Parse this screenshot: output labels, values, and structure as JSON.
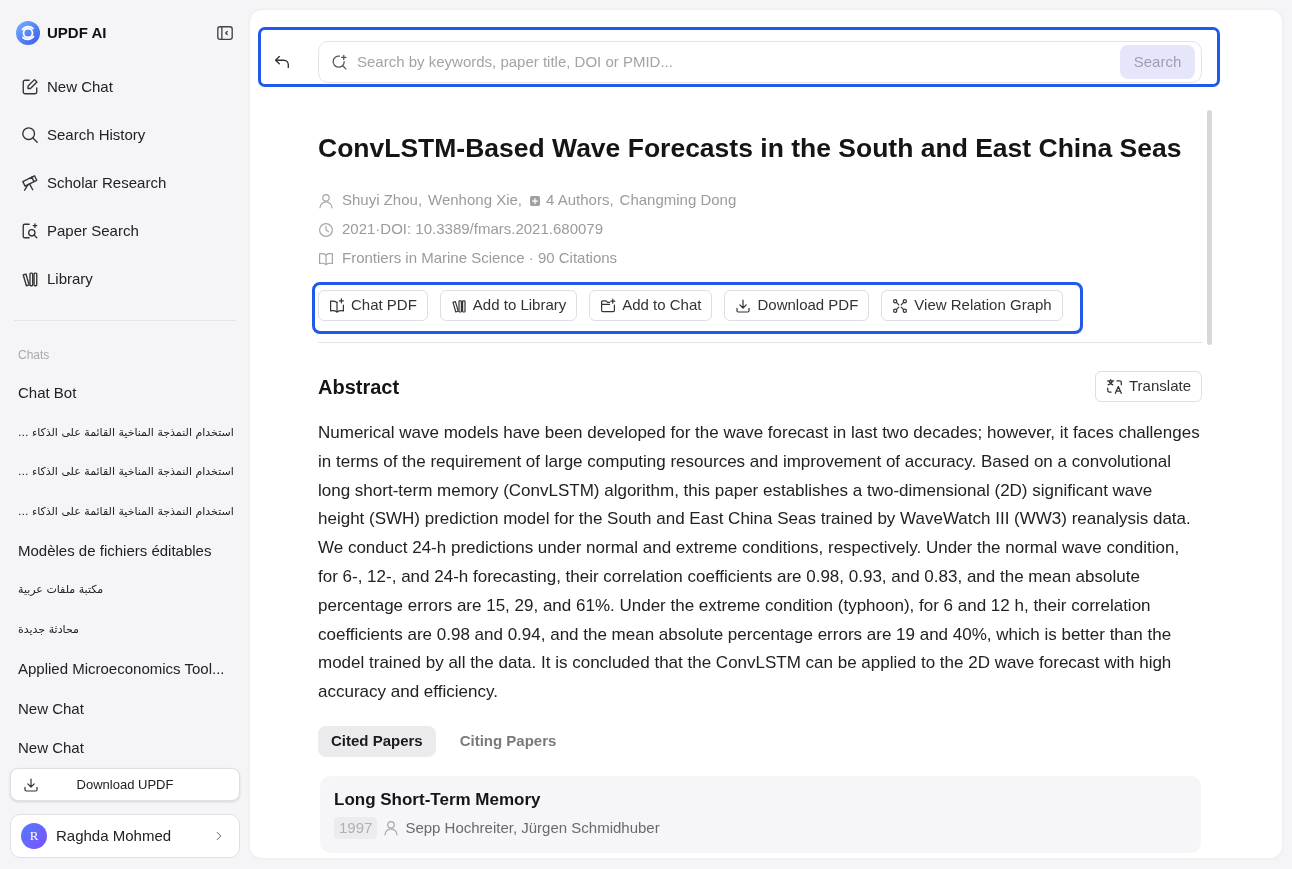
{
  "sidebar": {
    "logo_text": "UPDF AI",
    "nav": [
      {
        "label": "New Chat"
      },
      {
        "label": "Search History"
      },
      {
        "label": "Scholar Research"
      },
      {
        "label": "Paper Search"
      },
      {
        "label": "Library"
      }
    ],
    "chats_heading": "Chats",
    "chats": [
      {
        "kind": "ltr",
        "title": "Chat Bot"
      },
      {
        "kind": "rtl",
        "title": "استخدام النمذجة المناخية القائمة على الذكاء ..."
      },
      {
        "kind": "rtl",
        "title": "استخدام النمذجة المناخية القائمة على الذكاء ..."
      },
      {
        "kind": "rtl",
        "title": "استخدام النمذجة المناخية القائمة على الذكاء ..."
      },
      {
        "kind": "ltr",
        "title": "Modèles de fichiers éditables"
      },
      {
        "kind": "rtl",
        "title": "مكتبة ملفات عربية"
      },
      {
        "kind": "rtl",
        "title": "محادثة جديدة"
      },
      {
        "kind": "ltr",
        "title": "Applied Microeconomics Tool..."
      },
      {
        "kind": "ltr",
        "title": "New Chat"
      },
      {
        "kind": "ltr",
        "title": "New Chat"
      }
    ],
    "download_button": "Download UPDF",
    "user": {
      "avatar_letter": "R",
      "name": "Raghda Mohmed"
    }
  },
  "search": {
    "highlighted": true,
    "placeholder": "Search by keywords, paper title, DOI or PMID...",
    "button": "Search"
  },
  "paper": {
    "title": "ConvLSTM-Based Wave Forecasts in the South and East China Seas",
    "authors": [
      {
        "kind": "person",
        "name": "Shuyi Zhou,"
      },
      {
        "kind": "person",
        "name": "Wenhong Xie,"
      },
      {
        "kind": "more",
        "name": "4 Authors,"
      },
      {
        "kind": "person",
        "name": "Changming Dong"
      }
    ],
    "date_doi": "2021·DOI: 10.3389/fmars.2021.680079",
    "venue": "Frontiers in Marine Science · 90 Citations",
    "actions_highlighted": true,
    "actions": [
      "Chat PDF",
      "Add to Library",
      "Add to Chat",
      "Download PDF",
      "View Relation Graph"
    ]
  },
  "abstract": {
    "heading": "Abstract",
    "translate_button": "Translate",
    "text": "Numerical wave models have been developed for the wave forecast in last two decades; however, it faces challenges in terms of the requirement of large computing resources and improvement of accuracy. Based on a convolutional long short-term memory (ConvLSTM) algorithm, this paper establishes a two-dimensional (2D) significant wave height (SWH) prediction model for the South and East China Seas trained by WaveWatch III (WW3) reanalysis data. We conduct 24-h predictions under normal and extreme conditions, respectively. Under the normal wave condition, for 6-, 12-, and 24-h forecasting, their correlation coefficients are 0.98, 0.93, and 0.83, and the mean absolute percentage errors are 15, 29, and 61%. Under the extreme condition (typhoon), for 6 and 12 h, their correlation coefficients are 0.98 and 0.94, and the mean absolute percentage errors are 19 and 40%, which is better than the model trained by all the data. It is concluded that the ConvLSTM can be applied to the 2D wave forecast with high accuracy and efficiency."
  },
  "tabs": [
    {
      "label": "Cited Papers",
      "selected": true
    },
    {
      "label": "Citing Papers",
      "selected": false
    }
  ],
  "references": [
    {
      "title": "Long Short-Term Memory",
      "year": "1997",
      "authors": "Sepp Hochreiter, Jürgen Schmidhuber"
    }
  ]
}
